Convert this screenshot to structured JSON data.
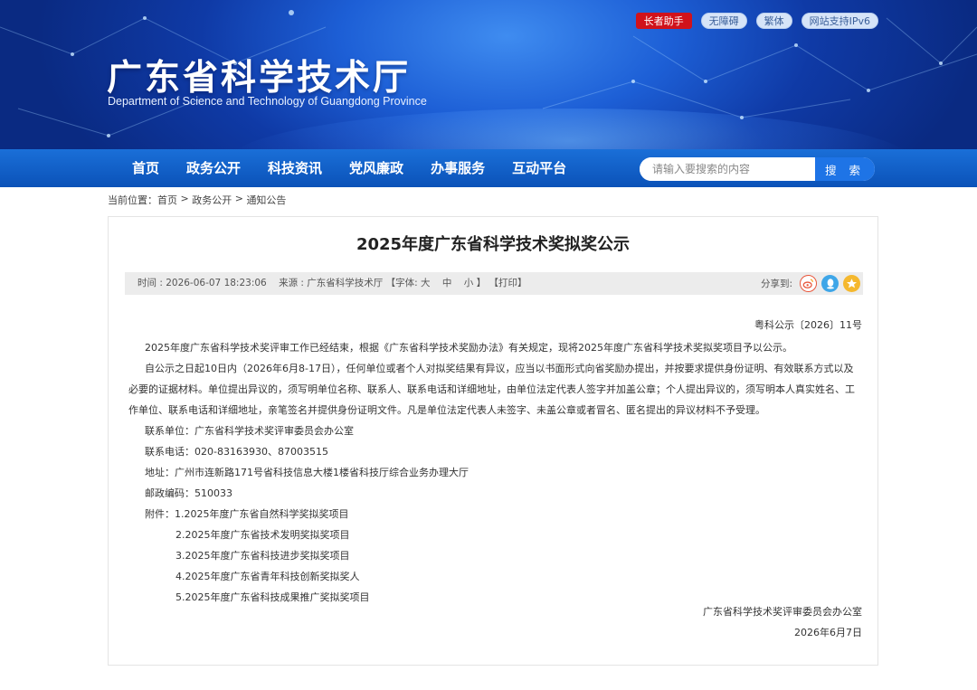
{
  "header": {
    "title": "广东省科学技术厅",
    "subtitle": "Department of Science and Technology of Guangdong Province",
    "toplinks": [
      "长者助手",
      "无障碍",
      "繁体",
      "网站支持IPv6"
    ]
  },
  "nav": {
    "items": [
      "首页",
      "政务公开",
      "科技资讯",
      "党风廉政",
      "办事服务",
      "互动平台"
    ],
    "search_placeholder": "请输入要搜索的内容",
    "search_button": "搜 索"
  },
  "breadcrumb": {
    "prefix": "当前位置：",
    "items": [
      "首页",
      "政务公开",
      "通知公告"
    ],
    "separator": " > "
  },
  "article": {
    "title": "2025年度广东省科学技术奖拟奖公示",
    "time_label": "时间 : 2026-06-07 18:23:06",
    "source_label": "来源 : 广东省科学技术厅",
    "font_label": "【字体:",
    "font_large": "大",
    "font_medium": "中",
    "font_small": "小",
    "font_close": "】",
    "print_label": "【打印】",
    "share_label": "分享到:",
    "share_icons": [
      "weibo-icon",
      "qq-icon",
      "qzone-icon"
    ],
    "doc_number": "粤科公示〔2026〕11号",
    "para1": "2025年度广东省科学技术奖评审工作已经结束，根据《广东省科学技术奖励办法》有关规定，现将2025年度广东省科学技术奖拟奖项目予以公示。",
    "para2": "自公示之日起10日内（2026年6月8-17日），任何单位或者个人对拟奖结果有异议，应当以书面形式向省奖励办提出，并按要求提供身份证明、有效联系方式以及必要的证据材料。单位提出异议的，须写明单位名称、联系人、联系电话和详细地址，由单位法定代表人签字并加盖公章；个人提出异议的，须写明本人真实姓名、工作单位、联系电话和详细地址，亲笔签名并提供身份证明文件。凡是单位法定代表人未签字、未盖公章或者冒名、匿名提出的异议材料不予受理。",
    "contact_unit": "联系单位：广东省科学技术奖评审委员会办公室",
    "contact_phone": "联系电话：020-83163930、87003515",
    "address": "地址：广州市连新路171号省科技信息大楼1楼省科技厅综合业务办理大厅",
    "postcode": "邮政编码：510033",
    "attachments_label": "附件：",
    "attachments": [
      "1.2025年度广东省自然科学奖拟奖项目",
      "2.2025年度广东省技术发明奖拟奖项目",
      "3.2025年度广东省科技进步奖拟奖项目",
      "4.2025年度广东省青年科技创新奖拟奖人",
      "5.2025年度广东省科技成果推广奖拟奖项目"
    ],
    "signature_org": "广东省科学技术奖评审委员会办公室",
    "signature_date": "2026年6月7日"
  },
  "colors": {
    "nav_blue": "#0b52b8",
    "accent_blue": "#1e74e6",
    "elder_red": "#d0121b"
  }
}
